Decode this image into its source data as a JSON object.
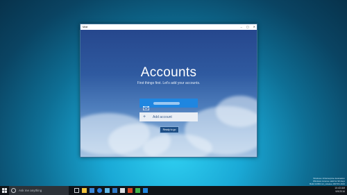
{
  "window": {
    "title": "Mail",
    "controls": [
      "–",
      "▢",
      "✕"
    ]
  },
  "main": {
    "heading": "Accounts",
    "subheading": "First things first. Let's add your accounts.",
    "account_icon": "mail-icon",
    "add_account_label": "Add account",
    "ready_button_label": "Ready to go"
  },
  "taskbar": {
    "search_placeholder": "Ask me anything",
    "icons": [
      "task-view-icon",
      "file-explorer-icon",
      "store-icon",
      "edge-icon",
      "media-icon",
      "photos-icon",
      "settings-icon",
      "office-icon",
      "app-icon",
      "mail-icon"
    ],
    "tray_time": "10:43 AM",
    "tray_date": "9/9/2016"
  },
  "desktop": {
    "watermark_line1": "Windows 10 Enterprise Evaluation",
    "watermark_line2": "Windows License valid for 90 days",
    "watermark_line3": "Build 14393.rs1_release.160715-1616"
  },
  "colors": {
    "accent": "#1f86e0",
    "taskbar": "#101418"
  }
}
